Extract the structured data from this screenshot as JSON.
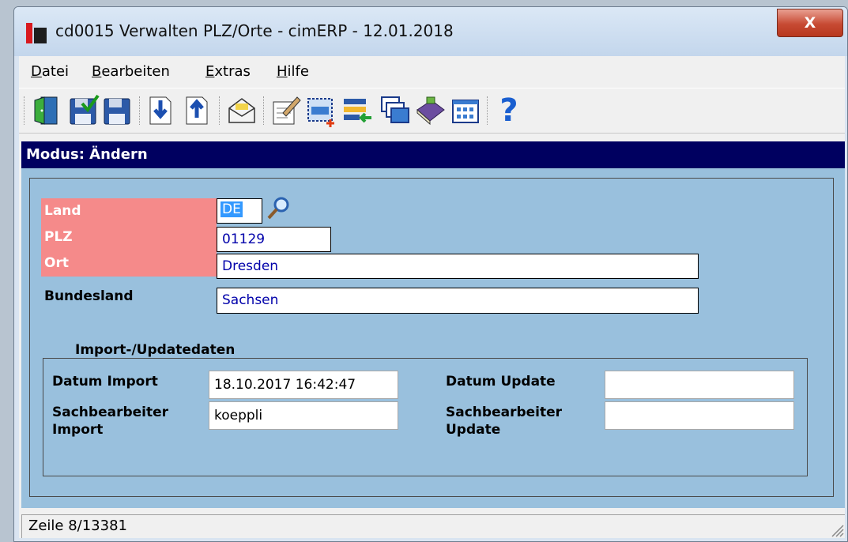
{
  "window": {
    "title": "cd0015 Verwalten PLZ/Orte - cimERP - 12.01.2018",
    "close_label": "X"
  },
  "menu": [
    {
      "u": "D",
      "rest": "atei"
    },
    {
      "u": "B",
      "rest": "earbeiten"
    },
    {
      "u": "E",
      "rest": "xtras"
    },
    {
      "u": "H",
      "rest": "ilfe"
    }
  ],
  "toolbar": {
    "icons": [
      "exit-door-icon",
      "save-check-icon",
      "save-icon",
      "move-down-icon",
      "move-up-icon",
      "mail-envelope-icon",
      "edit-document-icon",
      "new-selection-icon",
      "import-list-icon",
      "windows-stack-icon",
      "book-icon",
      "grid-table-icon",
      "help-icon"
    ],
    "help_glyph": "?"
  },
  "mode": "Modus: Ändern",
  "form": {
    "land_label": "Land",
    "land_value": "DE",
    "plz_label": "PLZ",
    "plz_value": "01129",
    "ort_label": "Ort",
    "ort_value": "Dresden",
    "bundesland_label": "Bundesland",
    "bundesland_value": "Sachsen"
  },
  "import": {
    "title": "Import-/Updatedaten",
    "datum_import_label": "Datum Import",
    "datum_import_value": "18.10.2017 16:42:47",
    "sb_import_label1": "Sachbearbeiter",
    "sb_import_label2": "Import",
    "sb_import_value": "koeppli",
    "datum_update_label": "Datum Update",
    "datum_update_value": "",
    "sb_update_label1": "Sachbearbeiter",
    "sb_update_label2": "Update",
    "sb_update_value": ""
  },
  "status": "Zeile 8/13381",
  "colors": {
    "mode_bar": "#000060",
    "panel": "#99c0dd",
    "required_label": "#f58a8a",
    "input_text": "#0000aa"
  }
}
